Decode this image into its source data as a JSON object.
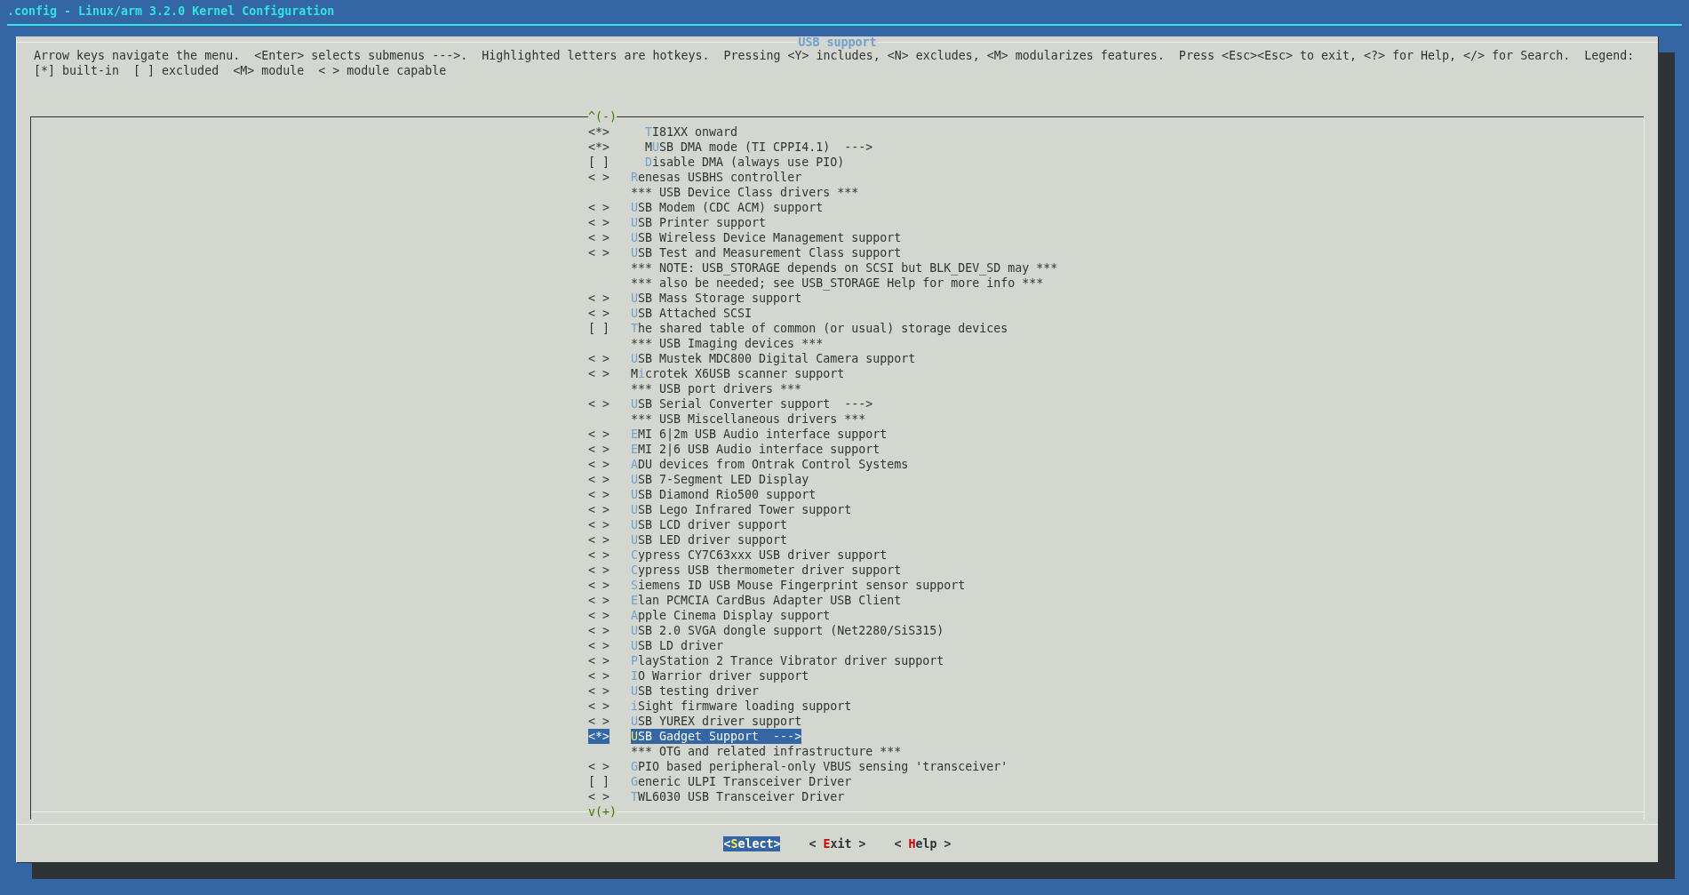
{
  "window": {
    "title": ".config - Linux/arm 3.2.0 Kernel Configuration"
  },
  "dialog": {
    "title": "USB support",
    "help_lines": [
      "Arrow keys navigate the menu.  <Enter> selects submenus --->.  Highlighted letters are hotkeys.  Pressing <Y> includes, <N> excludes, <M> modularizes features.  Press <Esc><Esc> to exit, <?> for Help, </> for Search.  Legend:",
      "[*] built-in  [ ] excluded  <M> module  < > module capable"
    ],
    "scroll_up": "^(-)",
    "scroll_down": "v(+)"
  },
  "items": [
    {
      "kind": "nested",
      "children": [
        {
          "kind": "option",
          "value": "<*>",
          "hotkey": "T",
          "rest": "I81XX onward",
          "selected": false
        },
        {
          "kind": "option",
          "value": "<*>",
          "pre": "M",
          "hotkey": "U",
          "rest": "SB DMA mode (TI CPPI4.1)  --->",
          "selected": false
        },
        {
          "kind": "option",
          "value": "[ ]",
          "hotkey": "D",
          "rest": "isable DMA (always use PIO)",
          "selected": false
        }
      ]
    },
    {
      "kind": "option",
      "value": "< >",
      "hotkey": "R",
      "rest": "enesas USBHS controller",
      "selected": false
    },
    {
      "kind": "comment",
      "text": "*** USB Device Class drivers ***"
    },
    {
      "kind": "option",
      "value": "< >",
      "hotkey": "U",
      "rest": "SB Modem (CDC ACM) support",
      "selected": false
    },
    {
      "kind": "option",
      "value": "< >",
      "hotkey": "U",
      "rest": "SB Printer support",
      "selected": false
    },
    {
      "kind": "option",
      "value": "< >",
      "hotkey": "U",
      "rest": "SB Wireless Device Management support",
      "selected": false
    },
    {
      "kind": "option",
      "value": "< >",
      "hotkey": "U",
      "rest": "SB Test and Measurement Class support",
      "selected": false
    },
    {
      "kind": "comment",
      "text": "*** NOTE: USB_STORAGE depends on SCSI but BLK_DEV_SD may ***"
    },
    {
      "kind": "comment",
      "text": "*** also be needed; see USB_STORAGE Help for more info ***"
    },
    {
      "kind": "option",
      "value": "< >",
      "hotkey": "U",
      "rest": "SB Mass Storage support",
      "selected": false
    },
    {
      "kind": "option",
      "value": "< >",
      "hotkey": "U",
      "rest": "SB Attached SCSI",
      "selected": false
    },
    {
      "kind": "option",
      "value": "[ ]",
      "hotkey": "T",
      "rest": "he shared table of common (or usual) storage devices",
      "selected": false
    },
    {
      "kind": "comment",
      "text": "*** USB Imaging devices ***"
    },
    {
      "kind": "option",
      "value": "< >",
      "hotkey": "U",
      "rest": "SB Mustek MDC800 Digital Camera support",
      "selected": false
    },
    {
      "kind": "option",
      "value": "< >",
      "pre": "M",
      "hotkey": "i",
      "rest": "crotek X6USB scanner support",
      "selected": false
    },
    {
      "kind": "comment",
      "text": "*** USB port drivers ***"
    },
    {
      "kind": "option",
      "value": "< >",
      "hotkey": "U",
      "rest": "SB Serial Converter support  --->",
      "selected": false
    },
    {
      "kind": "comment",
      "text": "*** USB Miscellaneous drivers ***"
    },
    {
      "kind": "option",
      "value": "< >",
      "hotkey": "E",
      "rest": "MI 6|2m USB Audio interface support",
      "selected": false
    },
    {
      "kind": "option",
      "value": "< >",
      "hotkey": "E",
      "rest": "MI 2|6 USB Audio interface support",
      "selected": false
    },
    {
      "kind": "option",
      "value": "< >",
      "hotkey": "A",
      "rest": "DU devices from Ontrak Control Systems",
      "selected": false
    },
    {
      "kind": "option",
      "value": "< >",
      "hotkey": "U",
      "rest": "SB 7-Segment LED Display",
      "selected": false
    },
    {
      "kind": "option",
      "value": "< >",
      "hotkey": "U",
      "rest": "SB Diamond Rio500 support",
      "selected": false
    },
    {
      "kind": "option",
      "value": "< >",
      "hotkey": "U",
      "rest": "SB Lego Infrared Tower support",
      "selected": false
    },
    {
      "kind": "option",
      "value": "< >",
      "hotkey": "U",
      "rest": "SB LCD driver support",
      "selected": false
    },
    {
      "kind": "option",
      "value": "< >",
      "hotkey": "U",
      "rest": "SB LED driver support",
      "selected": false
    },
    {
      "kind": "option",
      "value": "< >",
      "hotkey": "C",
      "rest": "ypress CY7C63xxx USB driver support",
      "selected": false
    },
    {
      "kind": "option",
      "value": "< >",
      "hotkey": "C",
      "rest": "ypress USB thermometer driver support",
      "selected": false
    },
    {
      "kind": "option",
      "value": "< >",
      "hotkey": "S",
      "rest": "iemens ID USB Mouse Fingerprint sensor support",
      "selected": false
    },
    {
      "kind": "option",
      "value": "< >",
      "hotkey": "E",
      "rest": "lan PCMCIA CardBus Adapter USB Client",
      "selected": false
    },
    {
      "kind": "option",
      "value": "< >",
      "hotkey": "A",
      "rest": "pple Cinema Display support",
      "selected": false
    },
    {
      "kind": "option",
      "value": "< >",
      "hotkey": "U",
      "rest": "SB 2.0 SVGA dongle support (Net2280/SiS315)",
      "selected": false
    },
    {
      "kind": "option",
      "value": "< >",
      "hotkey": "U",
      "rest": "SB LD driver",
      "selected": false
    },
    {
      "kind": "option",
      "value": "< >",
      "hotkey": "P",
      "rest": "layStation 2 Trance Vibrator driver support",
      "selected": false
    },
    {
      "kind": "option",
      "value": "< >",
      "hotkey": "I",
      "rest": "O Warrior driver support",
      "selected": false
    },
    {
      "kind": "option",
      "value": "< >",
      "hotkey": "U",
      "rest": "SB testing driver",
      "selected": false
    },
    {
      "kind": "option",
      "value": "< >",
      "hotkey": "i",
      "rest": "Sight firmware loading support",
      "selected": false
    },
    {
      "kind": "option",
      "value": "< >",
      "hotkey": "U",
      "rest": "SB YUREX driver support",
      "selected": false
    },
    {
      "kind": "option",
      "value": "<*>",
      "hotkey": "U",
      "rest": "SB Gadget Support  --->",
      "selected": true
    },
    {
      "kind": "comment",
      "text": "*** OTG and related infrastructure ***"
    },
    {
      "kind": "option",
      "value": "< >",
      "hotkey": "G",
      "rest": "PIO based peripheral-only VBUS sensing 'transceiver'",
      "selected": false
    },
    {
      "kind": "option",
      "value": "[ ]",
      "hotkey": "G",
      "rest": "eneric ULPI Transceiver Driver",
      "selected": false
    },
    {
      "kind": "option",
      "value": "< >",
      "hotkey": "T",
      "rest": "WL6030 USB Transceiver Driver",
      "selected": false
    }
  ],
  "buttons": [
    {
      "pre": "<",
      "hotkey": "S",
      "rest": "elect>",
      "selected": true
    },
    {
      "pre": "< ",
      "hotkey": "E",
      "rest": "xit >",
      "selected": false
    },
    {
      "pre": "< ",
      "hotkey": "H",
      "rest": "elp >",
      "selected": false
    }
  ]
}
